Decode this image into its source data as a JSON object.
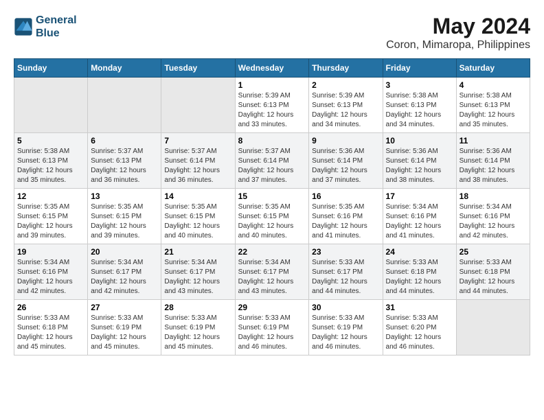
{
  "header": {
    "logo_line1": "General",
    "logo_line2": "Blue",
    "title": "May 2024",
    "subtitle": "Coron, Mimaropa, Philippines"
  },
  "days_of_week": [
    "Sunday",
    "Monday",
    "Tuesday",
    "Wednesday",
    "Thursday",
    "Friday",
    "Saturday"
  ],
  "weeks": [
    [
      {
        "day": "",
        "sunrise": "",
        "sunset": "",
        "daylight": ""
      },
      {
        "day": "",
        "sunrise": "",
        "sunset": "",
        "daylight": ""
      },
      {
        "day": "",
        "sunrise": "",
        "sunset": "",
        "daylight": ""
      },
      {
        "day": "1",
        "sunrise": "Sunrise: 5:39 AM",
        "sunset": "Sunset: 6:13 PM",
        "daylight": "Daylight: 12 hours and 33 minutes."
      },
      {
        "day": "2",
        "sunrise": "Sunrise: 5:39 AM",
        "sunset": "Sunset: 6:13 PM",
        "daylight": "Daylight: 12 hours and 34 minutes."
      },
      {
        "day": "3",
        "sunrise": "Sunrise: 5:38 AM",
        "sunset": "Sunset: 6:13 PM",
        "daylight": "Daylight: 12 hours and 34 minutes."
      },
      {
        "day": "4",
        "sunrise": "Sunrise: 5:38 AM",
        "sunset": "Sunset: 6:13 PM",
        "daylight": "Daylight: 12 hours and 35 minutes."
      }
    ],
    [
      {
        "day": "5",
        "sunrise": "Sunrise: 5:38 AM",
        "sunset": "Sunset: 6:13 PM",
        "daylight": "Daylight: 12 hours and 35 minutes."
      },
      {
        "day": "6",
        "sunrise": "Sunrise: 5:37 AM",
        "sunset": "Sunset: 6:13 PM",
        "daylight": "Daylight: 12 hours and 36 minutes."
      },
      {
        "day": "7",
        "sunrise": "Sunrise: 5:37 AM",
        "sunset": "Sunset: 6:14 PM",
        "daylight": "Daylight: 12 hours and 36 minutes."
      },
      {
        "day": "8",
        "sunrise": "Sunrise: 5:37 AM",
        "sunset": "Sunset: 6:14 PM",
        "daylight": "Daylight: 12 hours and 37 minutes."
      },
      {
        "day": "9",
        "sunrise": "Sunrise: 5:36 AM",
        "sunset": "Sunset: 6:14 PM",
        "daylight": "Daylight: 12 hours and 37 minutes."
      },
      {
        "day": "10",
        "sunrise": "Sunrise: 5:36 AM",
        "sunset": "Sunset: 6:14 PM",
        "daylight": "Daylight: 12 hours and 38 minutes."
      },
      {
        "day": "11",
        "sunrise": "Sunrise: 5:36 AM",
        "sunset": "Sunset: 6:14 PM",
        "daylight": "Daylight: 12 hours and 38 minutes."
      }
    ],
    [
      {
        "day": "12",
        "sunrise": "Sunrise: 5:35 AM",
        "sunset": "Sunset: 6:15 PM",
        "daylight": "Daylight: 12 hours and 39 minutes."
      },
      {
        "day": "13",
        "sunrise": "Sunrise: 5:35 AM",
        "sunset": "Sunset: 6:15 PM",
        "daylight": "Daylight: 12 hours and 39 minutes."
      },
      {
        "day": "14",
        "sunrise": "Sunrise: 5:35 AM",
        "sunset": "Sunset: 6:15 PM",
        "daylight": "Daylight: 12 hours and 40 minutes."
      },
      {
        "day": "15",
        "sunrise": "Sunrise: 5:35 AM",
        "sunset": "Sunset: 6:15 PM",
        "daylight": "Daylight: 12 hours and 40 minutes."
      },
      {
        "day": "16",
        "sunrise": "Sunrise: 5:35 AM",
        "sunset": "Sunset: 6:16 PM",
        "daylight": "Daylight: 12 hours and 41 minutes."
      },
      {
        "day": "17",
        "sunrise": "Sunrise: 5:34 AM",
        "sunset": "Sunset: 6:16 PM",
        "daylight": "Daylight: 12 hours and 41 minutes."
      },
      {
        "day": "18",
        "sunrise": "Sunrise: 5:34 AM",
        "sunset": "Sunset: 6:16 PM",
        "daylight": "Daylight: 12 hours and 42 minutes."
      }
    ],
    [
      {
        "day": "19",
        "sunrise": "Sunrise: 5:34 AM",
        "sunset": "Sunset: 6:16 PM",
        "daylight": "Daylight: 12 hours and 42 minutes."
      },
      {
        "day": "20",
        "sunrise": "Sunrise: 5:34 AM",
        "sunset": "Sunset: 6:17 PM",
        "daylight": "Daylight: 12 hours and 42 minutes."
      },
      {
        "day": "21",
        "sunrise": "Sunrise: 5:34 AM",
        "sunset": "Sunset: 6:17 PM",
        "daylight": "Daylight: 12 hours and 43 minutes."
      },
      {
        "day": "22",
        "sunrise": "Sunrise: 5:34 AM",
        "sunset": "Sunset: 6:17 PM",
        "daylight": "Daylight: 12 hours and 43 minutes."
      },
      {
        "day": "23",
        "sunrise": "Sunrise: 5:33 AM",
        "sunset": "Sunset: 6:17 PM",
        "daylight": "Daylight: 12 hours and 44 minutes."
      },
      {
        "day": "24",
        "sunrise": "Sunrise: 5:33 AM",
        "sunset": "Sunset: 6:18 PM",
        "daylight": "Daylight: 12 hours and 44 minutes."
      },
      {
        "day": "25",
        "sunrise": "Sunrise: 5:33 AM",
        "sunset": "Sunset: 6:18 PM",
        "daylight": "Daylight: 12 hours and 44 minutes."
      }
    ],
    [
      {
        "day": "26",
        "sunrise": "Sunrise: 5:33 AM",
        "sunset": "Sunset: 6:18 PM",
        "daylight": "Daylight: 12 hours and 45 minutes."
      },
      {
        "day": "27",
        "sunrise": "Sunrise: 5:33 AM",
        "sunset": "Sunset: 6:19 PM",
        "daylight": "Daylight: 12 hours and 45 minutes."
      },
      {
        "day": "28",
        "sunrise": "Sunrise: 5:33 AM",
        "sunset": "Sunset: 6:19 PM",
        "daylight": "Daylight: 12 hours and 45 minutes."
      },
      {
        "day": "29",
        "sunrise": "Sunrise: 5:33 AM",
        "sunset": "Sunset: 6:19 PM",
        "daylight": "Daylight: 12 hours and 46 minutes."
      },
      {
        "day": "30",
        "sunrise": "Sunrise: 5:33 AM",
        "sunset": "Sunset: 6:19 PM",
        "daylight": "Daylight: 12 hours and 46 minutes."
      },
      {
        "day": "31",
        "sunrise": "Sunrise: 5:33 AM",
        "sunset": "Sunset: 6:20 PM",
        "daylight": "Daylight: 12 hours and 46 minutes."
      },
      {
        "day": "",
        "sunrise": "",
        "sunset": "",
        "daylight": ""
      }
    ]
  ]
}
